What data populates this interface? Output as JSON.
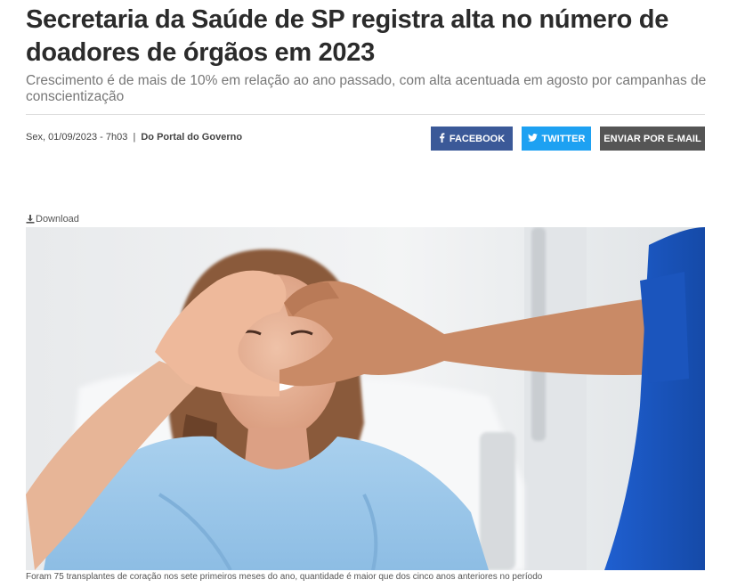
{
  "article": {
    "headline": "Secretaria da Saúde de SP registra alta no número de doadores de órgãos em 2023",
    "subheadline": "Crescimento é de mais de 10% em relação ao ano passado, com alta acentuada em agosto por campanhas de conscientização",
    "date": "Sex, 01/09/2023 - 7h03",
    "separator": "|",
    "source": "Do Portal do Governo"
  },
  "share": {
    "facebook_label": "FACEBOOK",
    "twitter_label": "TWITTER",
    "email_label": "ENVIAR POR E-MAIL",
    "facebook_color": "#3b5998",
    "twitter_color": "#1da1f2",
    "email_color": "#555555",
    "facebook_icon": "facebook-icon",
    "twitter_icon": "twitter-icon"
  },
  "download": {
    "label": "Download",
    "icon": "download-icon"
  },
  "photo": {
    "caption": "Foram 75 transplantes de coração nos sete primeiros meses do ano, quantidade é maior que dos cinco anos anteriores no período"
  }
}
